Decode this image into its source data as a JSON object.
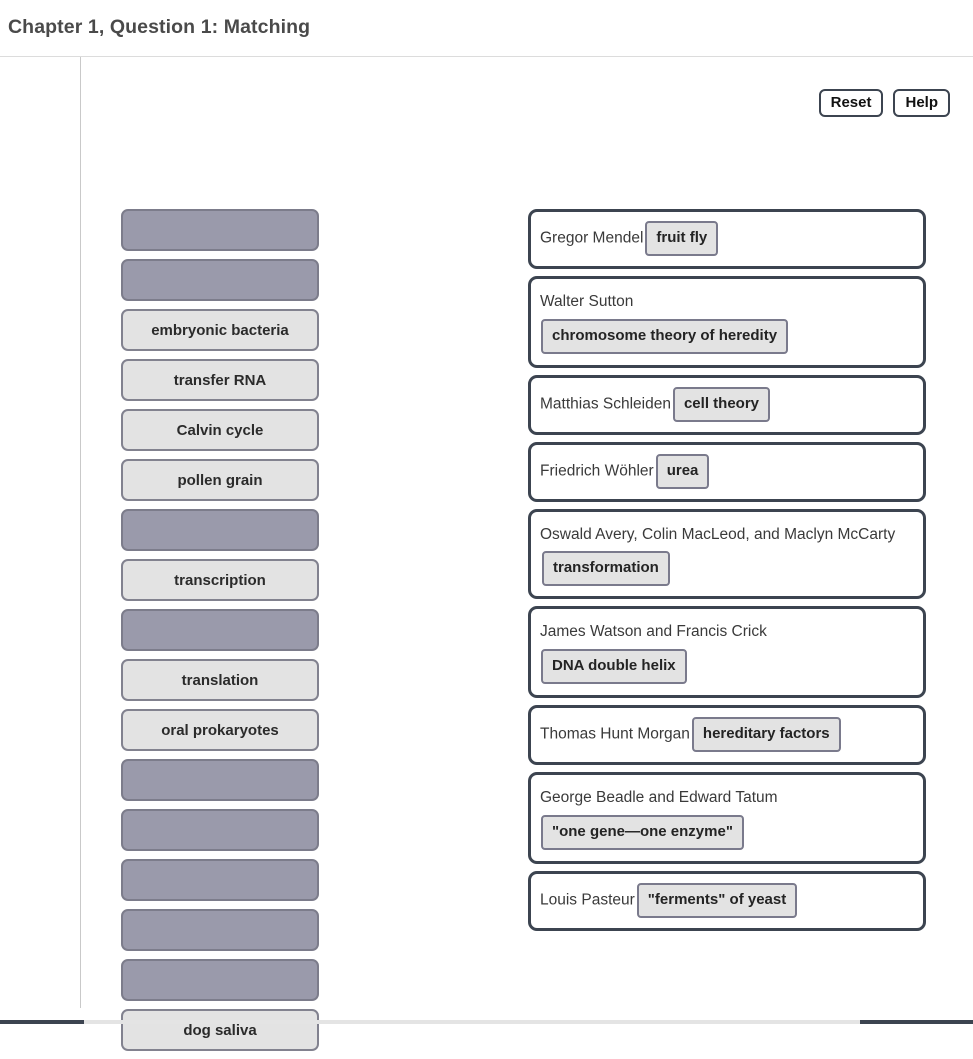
{
  "header": {
    "title": "Chapter 1, Question 1: Matching"
  },
  "toolbar": {
    "reset_label": "Reset",
    "help_label": "Help"
  },
  "colors": {
    "empty_slot_fill": "#9a9aab",
    "tile_fill": "#e3e3e3",
    "card_border": "#3c4450",
    "chip_border": "#7a7a8c"
  },
  "bank": {
    "tiles": [
      {
        "label": "",
        "empty": true
      },
      {
        "label": "",
        "empty": true
      },
      {
        "label": "embryonic bacteria",
        "empty": false
      },
      {
        "label": "transfer RNA",
        "empty": false
      },
      {
        "label": "Calvin cycle",
        "empty": false
      },
      {
        "label": "pollen grain",
        "empty": false
      },
      {
        "label": "",
        "empty": true
      },
      {
        "label": "transcription",
        "empty": false
      },
      {
        "label": "",
        "empty": true
      },
      {
        "label": "translation",
        "empty": false
      },
      {
        "label": "oral prokaryotes",
        "empty": false
      },
      {
        "label": "",
        "empty": true
      },
      {
        "label": "",
        "empty": true
      },
      {
        "label": "",
        "empty": true
      },
      {
        "label": "",
        "empty": true
      },
      {
        "label": "",
        "empty": true
      },
      {
        "label": "dog saliva",
        "empty": false
      }
    ]
  },
  "matches": [
    {
      "prompt": "Gregor Mendel",
      "answer": "fruit fly",
      "stacked": false
    },
    {
      "prompt": "Walter Sutton",
      "answer": "chromosome theory of heredity",
      "stacked": true
    },
    {
      "prompt": "Matthias Schleiden",
      "answer": "cell theory",
      "stacked": false
    },
    {
      "prompt": "Friedrich Wöhler",
      "answer": "urea",
      "stacked": false
    },
    {
      "prompt": "Oswald Avery, Colin MacLeod, and Maclyn McCarty",
      "answer": "transformation",
      "stacked": false
    },
    {
      "prompt": "James Watson and Francis Crick",
      "answer": "DNA double helix",
      "stacked": true
    },
    {
      "prompt": "Thomas Hunt Morgan",
      "answer": "hereditary factors",
      "stacked": false
    },
    {
      "prompt": "George Beadle and Edward Tatum",
      "answer": "\"one gene—one enzyme\"",
      "stacked": true
    },
    {
      "prompt": "Louis Pasteur",
      "answer": "\"ferments\" of yeast",
      "stacked": false
    }
  ]
}
